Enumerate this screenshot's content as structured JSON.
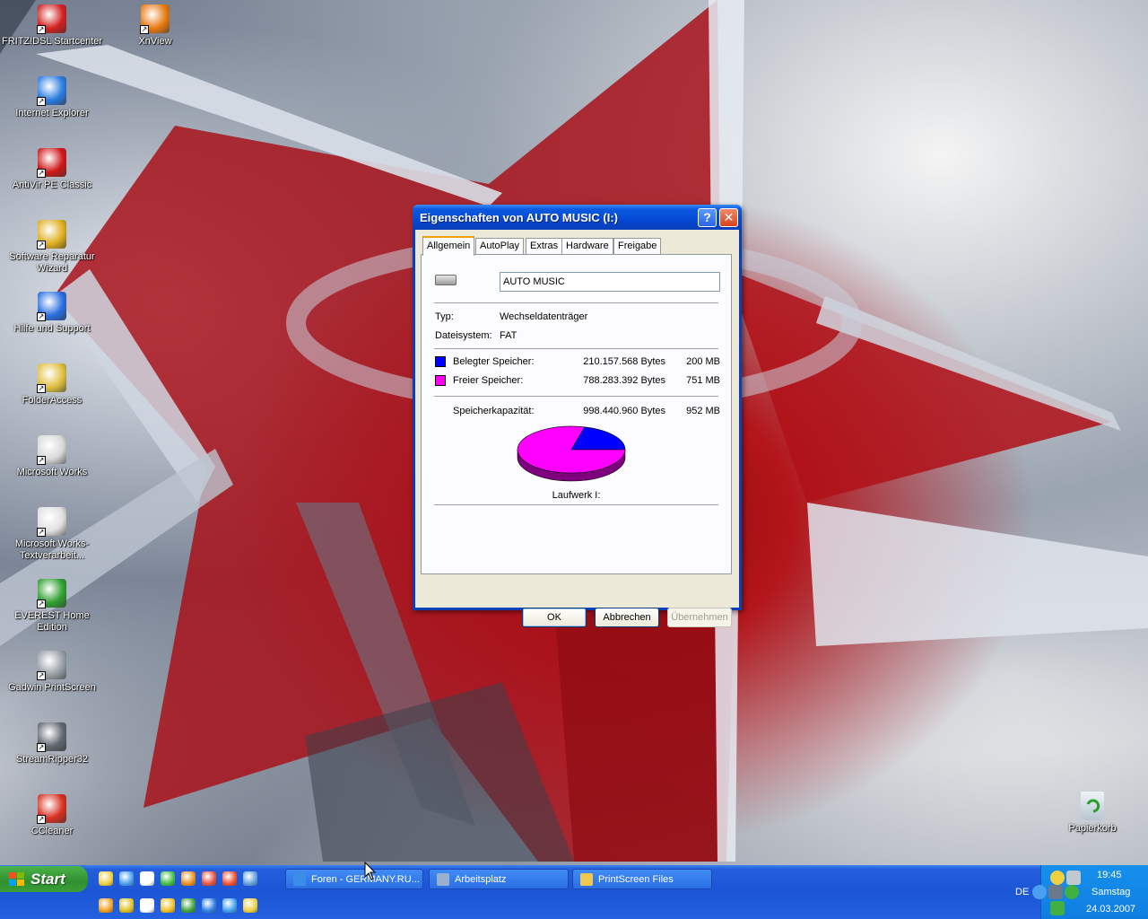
{
  "desktop": {
    "icons": [
      {
        "label": "FRITZ!DSL Startcenter",
        "icon": "fritz-icon",
        "color": "#d42020"
      },
      {
        "label": "XnView",
        "icon": "xnview-icon",
        "color": "#e87a10"
      },
      {
        "label": "Internet Explorer",
        "icon": "internet-explorer-icon",
        "color": "#2a7de0"
      },
      {
        "label": "AntiVir PE Classic",
        "icon": "antivir-icon",
        "color": "#d01818"
      },
      {
        "label": "Software Reparatur Wizard",
        "icon": "repair-wizard-icon",
        "color": "#e0b020"
      },
      {
        "label": "Hilfe und Support",
        "icon": "help-support-icon",
        "color": "#2a6ee0"
      },
      {
        "label": "FolderAccess",
        "icon": "folderaccess-icon",
        "color": "#e0c040"
      },
      {
        "label": "Microsoft Works",
        "icon": "ms-works-icon",
        "color": "#d8d8d8"
      },
      {
        "label": "Microsoft Works-Textverarbeit...",
        "icon": "works-text-icon",
        "color": "#e0e0e0"
      },
      {
        "label": "EVEREST Home Edition",
        "icon": "everest-icon",
        "color": "#30a030"
      },
      {
        "label": "Gadwin PrintScreen",
        "icon": "gadwin-icon",
        "color": "#9aa0a8"
      },
      {
        "label": "StreamRipper32",
        "icon": "streamripper-icon",
        "color": "#606870"
      },
      {
        "label": "CCleaner",
        "icon": "ccleaner-icon",
        "color": "#d83020"
      }
    ],
    "recycle_bin": {
      "label": "Papierkorb",
      "icon": "recycle-bin-icon"
    }
  },
  "dialog": {
    "title": "Eigenschaften von AUTO MUSIC (I:)",
    "help_glyph": "?",
    "close_glyph": "✕",
    "tabs": [
      "Allgemein",
      "AutoPlay",
      "Extras",
      "Hardware",
      "Freigabe"
    ],
    "active_tab": "Allgemein",
    "volume_name": "AUTO MUSIC",
    "type_label": "Typ:",
    "type_value": "Wechseldatenträger",
    "fs_label": "Dateisystem:",
    "fs_value": "FAT",
    "used_label": "Belegter Speicher:",
    "used_bytes": "210.157.568 Bytes",
    "used_size": "200 MB",
    "free_label": "Freier Speicher:",
    "free_bytes": "788.283.392 Bytes",
    "free_size": "751 MB",
    "capacity_label": "Speicherkapazität:",
    "capacity_bytes": "998.440.960 Bytes",
    "capacity_size": "952 MB",
    "drive_caption": "Laufwerk I:",
    "ok": "OK",
    "cancel": "Abbrechen",
    "apply": "Übernehmen"
  },
  "chart_data": {
    "type": "pie",
    "labels": [
      "Belegter Speicher",
      "Freier Speicher"
    ],
    "values": [
      210157568,
      788283392
    ],
    "colors": [
      "#0000ff",
      "#ff00ff"
    ],
    "shadow_colors": [
      "#00007f",
      "#7f007f"
    ]
  },
  "taskbar": {
    "start_label": "Start",
    "tasks": [
      {
        "label": "Foren - GERMANY.RU...",
        "icon": "ie-task-icon",
        "color": "#3a8de8"
      },
      {
        "label": "Arbeitsplatz",
        "icon": "my-computer-task-icon",
        "color": "#9ab0d0"
      },
      {
        "label": "PrintScreen Files",
        "icon": "folder-task-icon",
        "color": "#f0c850"
      }
    ],
    "quicklaunch_colors": [
      "#f0d040",
      "#4aa0f0",
      "#ffffff",
      "#40c040",
      "#e89020",
      "#e85040",
      "#f05030",
      "#60a0e0",
      "#f0a020",
      "#e0c020",
      "#ffffff",
      "#f0c020",
      "#40a040",
      "#3080e0",
      "#40a0f0",
      "#f0d040"
    ],
    "tray": {
      "language": "DE",
      "time": "19:45",
      "day": "Samstag",
      "date": "24.03.2007"
    }
  }
}
